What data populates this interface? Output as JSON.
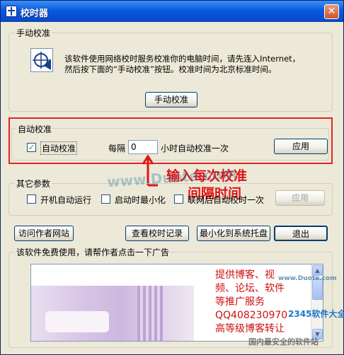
{
  "window": {
    "title": "校时器",
    "close_glyph": "✕"
  },
  "manual": {
    "legend": "手动校准",
    "description_line1": "该软件使用网络校时服务校准你的电脑时间，请先连入Internet，",
    "description_line2": "然后按下面的“手动校准”按钮。校准时间为北京标准时间。",
    "button": "手动校准"
  },
  "auto": {
    "legend": "自动校准",
    "checkbox_label": "自动校准",
    "checked": true,
    "interval_prefix": "每隔",
    "interval_value": "0",
    "interval_suffix": "小时自动校准一次",
    "apply_button": "应用"
  },
  "annotation": {
    "line1": "输入每次校准",
    "line2": "间隔时间"
  },
  "other": {
    "legend": "其它参数",
    "option1": "开机自动运行",
    "option2": "启动时最小化",
    "option3": "联网后自动校时一次",
    "apply_button": "应用"
  },
  "actions": {
    "visit": "访问作者网站",
    "log": "查看校时记录",
    "tray": "最小化到系统托盘",
    "exit": "退出"
  },
  "ad": {
    "legend": "该软件免费使用，请帮作者点击一下广告",
    "lines": [
      "提供博客、视",
      "频、论坛、软件",
      "等推广服务",
      "QQ408230970",
      "高等级博客转让"
    ]
  },
  "watermarks": {
    "center": "www.Duote.com",
    "site": "www.Duote.com",
    "brand": "2345软件大全",
    "bottom": "国内最安全的软件站"
  },
  "colors": {
    "annotation": "#e01414",
    "accent": "#0b5ce0"
  },
  "icons": {
    "arrow": "arrow-up-icon",
    "clock": "sync-clock-icon"
  }
}
